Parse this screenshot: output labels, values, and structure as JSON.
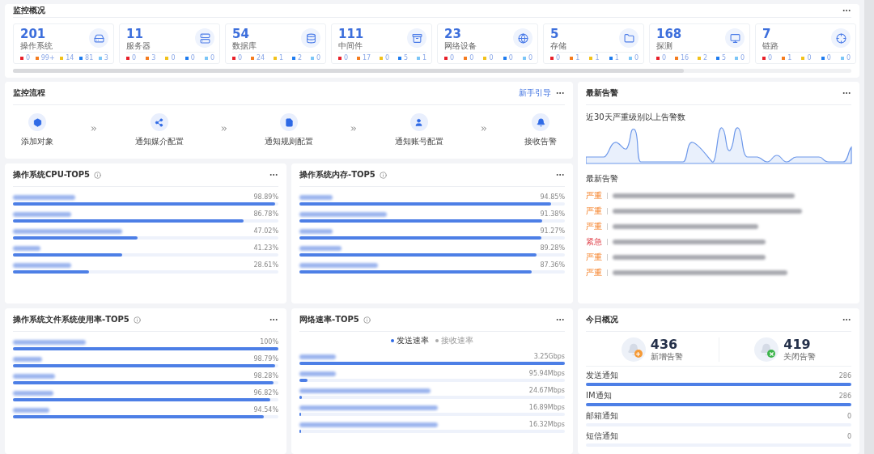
{
  "overview": {
    "title": "监控概况",
    "cards": [
      {
        "count": "201",
        "label": "操作系统",
        "stats": [
          "0",
          "99+",
          "14",
          "81",
          "3"
        ]
      },
      {
        "count": "11",
        "label": "服务器",
        "stats": [
          "0",
          "3",
          "0",
          "0",
          "0"
        ]
      },
      {
        "count": "54",
        "label": "数据库",
        "stats": [
          "0",
          "24",
          "1",
          "2",
          "0"
        ]
      },
      {
        "count": "111",
        "label": "中间件",
        "stats": [
          "0",
          "17",
          "0",
          "5",
          "1"
        ]
      },
      {
        "count": "23",
        "label": "网络设备",
        "stats": [
          "0",
          "0",
          "0",
          "0",
          "0"
        ]
      },
      {
        "count": "5",
        "label": "存储",
        "stats": [
          "0",
          "1",
          "1",
          "1",
          "0"
        ]
      },
      {
        "count": "168",
        "label": "探测",
        "stats": [
          "0",
          "16",
          "2",
          "5",
          "0"
        ]
      },
      {
        "count": "7",
        "label": "链路",
        "stats": [
          "0",
          "1",
          "0",
          "0",
          "0"
        ]
      }
    ]
  },
  "flow": {
    "title": "监控流程",
    "guide_link": "新手引导",
    "steps": [
      {
        "label": "添加对象"
      },
      {
        "label": "通知媒介配置"
      },
      {
        "label": "通知规则配置"
      },
      {
        "label": "通知账号配置"
      },
      {
        "label": "接收告警"
      }
    ]
  },
  "alerts": {
    "title": "最新告警",
    "chart_caption": "近30天严重级别以上告警数",
    "list_title": "最新告警",
    "items": [
      {
        "level": "严重",
        "kind": "severe"
      },
      {
        "level": "严重",
        "kind": "severe"
      },
      {
        "level": "严重",
        "kind": "severe"
      },
      {
        "level": "紧急",
        "kind": "urgent"
      },
      {
        "level": "严重",
        "kind": "severe"
      },
      {
        "level": "严重",
        "kind": "severe"
      }
    ]
  },
  "cpu": {
    "title": "操作系统CPU-TOP5",
    "rows": [
      {
        "value": "98.89%",
        "level": 0.9889
      },
      {
        "value": "86.78%",
        "level": 0.8678
      },
      {
        "value": "47.02%",
        "level": 0.4702
      },
      {
        "value": "41.23%",
        "level": 0.4123
      },
      {
        "value": "28.61%",
        "level": 0.2861
      }
    ]
  },
  "memory": {
    "title": "操作系统内存-TOP5",
    "rows": [
      {
        "value": "94.85%",
        "level": 0.9485
      },
      {
        "value": "91.38%",
        "level": 0.9138
      },
      {
        "value": "91.27%",
        "level": 0.9127
      },
      {
        "value": "89.28%",
        "level": 0.8928
      },
      {
        "value": "87.36%",
        "level": 0.8736
      }
    ]
  },
  "filesystem": {
    "title": "操作系统文件系统使用率-TOP5",
    "rows": [
      {
        "value": "100%",
        "level": 1
      },
      {
        "value": "98.79%",
        "level": 0.9879
      },
      {
        "value": "98.28%",
        "level": 0.9828
      },
      {
        "value": "96.82%",
        "level": 0.9682
      },
      {
        "value": "94.54%",
        "level": 0.9454
      }
    ]
  },
  "network": {
    "title": "网络速率-TOP5",
    "legend": [
      {
        "label": "发送速率",
        "selected": true
      },
      {
        "label": "接收速率",
        "selected": false
      }
    ],
    "rows": [
      {
        "value": "3.25Gbps",
        "level": 1
      },
      {
        "value": "95.94Mbps",
        "level": 0.03
      },
      {
        "value": "24.67Mbps",
        "level": 0.008
      },
      {
        "value": "16.89Mbps",
        "level": 0.005
      },
      {
        "value": "16.32Mbps",
        "level": 0.005
      }
    ]
  },
  "today": {
    "title": "今日概况",
    "stats": [
      {
        "count": "436",
        "label": "新增告警",
        "kind": "new"
      },
      {
        "count": "419",
        "label": "关闭告警",
        "kind": "closed"
      }
    ],
    "rows": [
      {
        "label": "发送通知",
        "value": "286",
        "level": 1
      },
      {
        "label": "IM通知",
        "value": "286",
        "level": 1
      },
      {
        "label": "邮箱通知",
        "value": "0",
        "level": 0
      },
      {
        "label": "短信通知",
        "value": "0",
        "level": 0
      }
    ]
  }
}
